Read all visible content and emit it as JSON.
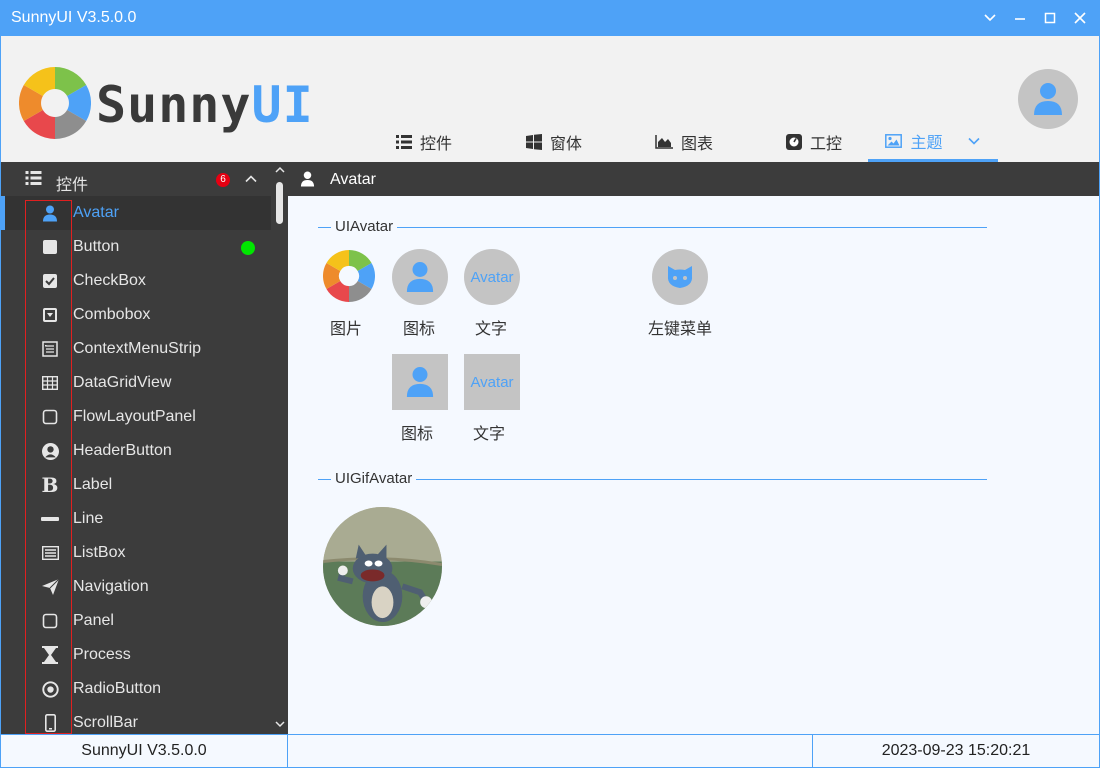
{
  "window": {
    "title": "SunnyUI V3.5.0.0"
  },
  "header": {
    "logo_text_a": "Sunny",
    "logo_text_b": "UI",
    "tabs": [
      {
        "label": "控件",
        "icon": "list-icon"
      },
      {
        "label": "窗体",
        "icon": "windows-icon"
      },
      {
        "label": "图表",
        "icon": "area-chart-icon"
      },
      {
        "label": "工控",
        "icon": "gauge-icon"
      },
      {
        "label": "主题",
        "icon": "image-icon",
        "active": true
      }
    ]
  },
  "sidebar": {
    "header": {
      "label": "控件",
      "badge": "6"
    },
    "items": [
      {
        "label": "Avatar",
        "icon": "user-icon",
        "active": true
      },
      {
        "label": "Button",
        "icon": "square-icon",
        "status_dot": "#00e600"
      },
      {
        "label": "CheckBox",
        "icon": "checkbox-icon"
      },
      {
        "label": "Combobox",
        "icon": "dropdown-box-icon"
      },
      {
        "label": "ContextMenuStrip",
        "icon": "menu-list-icon"
      },
      {
        "label": "DataGridView",
        "icon": "grid-icon"
      },
      {
        "label": "FlowLayoutPanel",
        "icon": "square-outline-icon"
      },
      {
        "label": "HeaderButton",
        "icon": "user-circle-icon"
      },
      {
        "label": "Label",
        "icon": "bold-b-icon"
      },
      {
        "label": "Line",
        "icon": "minus-icon"
      },
      {
        "label": "ListBox",
        "icon": "list-box-icon"
      },
      {
        "label": "Navigation",
        "icon": "paper-plane-icon"
      },
      {
        "label": "Panel",
        "icon": "square-outline-icon"
      },
      {
        "label": "Process",
        "icon": "hourglass-icon"
      },
      {
        "label": "RadioButton",
        "icon": "radio-icon"
      },
      {
        "label": "ScrollBar",
        "icon": "mobile-icon"
      }
    ]
  },
  "main": {
    "title": "Avatar",
    "groups": [
      {
        "title": "UIAvatar",
        "items": [
          {
            "caption": "图片",
            "kind": "image"
          },
          {
            "caption": "图标",
            "kind": "icon"
          },
          {
            "caption": "文字",
            "kind": "text",
            "text": "Avatar"
          },
          {
            "caption": "左键菜单",
            "kind": "icon-github"
          },
          {
            "caption": "图标",
            "kind": "icon-square"
          },
          {
            "caption": "文字",
            "kind": "text-square",
            "text": "Avatar"
          }
        ]
      },
      {
        "title": "UIGifAvatar"
      }
    ]
  },
  "status": {
    "version": "SunnyUI V3.5.0.0",
    "middle": "",
    "datetime": "2023-09-23 15:20:21"
  },
  "colors": {
    "accent": "#4ea2f7",
    "sidebar_bg": "#3c3c3c",
    "badge": "#e60012"
  }
}
